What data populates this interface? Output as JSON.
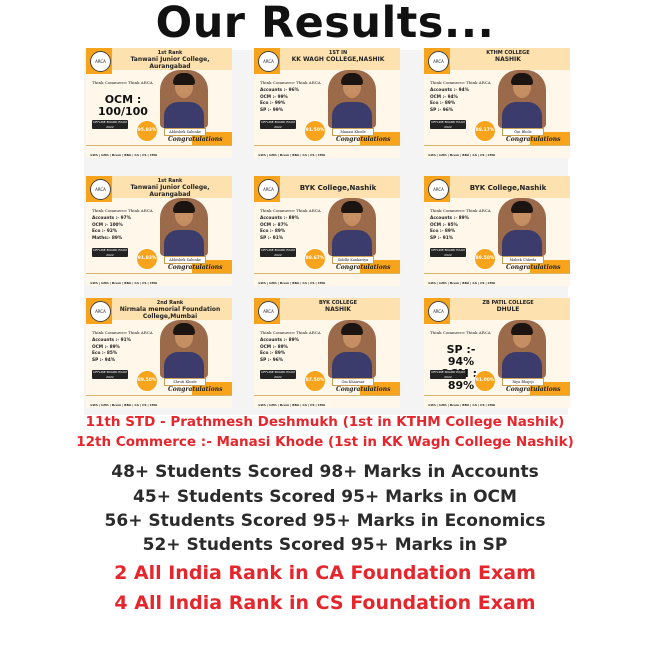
{
  "title": "Our Results...",
  "cards": [
    {
      "rank": "1st Rank",
      "college": "Tanwani Junior College, Aurangabad",
      "think": "Think Commerce Think ARCA",
      "marks": [],
      "big": "OCM : 100/100",
      "board": "OFFLINE BOARD EXAM 2022",
      "percent": "95.83%",
      "name": "Abhishek Salunke",
      "congrats": "Congratulations",
      "footer": "11th | 12th | Bcom | BBA | CA | CS | CMA",
      "logo": "ARCA"
    },
    {
      "rank": "1ST IN",
      "college": "KK WAGH COLLEGE,NASHIK",
      "think": "Think Commerce Think ARCA",
      "marks": [
        "Accounts :- 96%",
        "OCM :- 99%",
        "Eco :- 99%",
        "SP :- 99%"
      ],
      "big": "",
      "board": "OFFLINE BOARD EXAM 2022",
      "percent": "91.50%",
      "name": "Manasi Khode",
      "congrats": "Congratulations",
      "footer": "11th | 12th | Bcom | BBA | CA | CS | CMA",
      "logo": "ARCA"
    },
    {
      "rank": "KTHM COLLEGE",
      "college": "NASHIK",
      "think": "Think Commerce Think ARCA",
      "marks": [
        "Accounts :- 94%",
        "OCM :- 94%",
        "Eco :- 89%",
        "SP :- 96%"
      ],
      "big": "",
      "board": "OFFLINE BOARD EXAM 2022",
      "percent": "88.17%",
      "name": "Om Bhole",
      "congrats": "Congratulations",
      "footer": "11th | 12th | Bcom | BBA | CA | CS | CMA",
      "logo": "ARCA"
    },
    {
      "rank": "1st Rank",
      "college": "Tanwani Junior College, Aurangabad",
      "think": "Think Commerce Think ARCA",
      "marks": [
        "Accounts :- 97%",
        "OCM :- 100%",
        "Eco :- 92%",
        "Maths:- 89%"
      ],
      "big": "",
      "board": "OFFLINE BOARD EXAM 2022",
      "percent": "91.83%",
      "name": "Abhishek Salunke",
      "congrats": "Congratulations",
      "footer": "11th | 12th | Bcom | BBA | CA | CS | CMA",
      "logo": "ARCA"
    },
    {
      "rank": "BYK College,Nashik",
      "college": "",
      "think": "Think Commerce Think ARCA",
      "marks": [
        "Accounts :- 89%",
        "OCM :- 87%",
        "Eco :- 89%",
        "SP :- 91%"
      ],
      "big": "",
      "board": "OFFLINE BOARD EXAM 2022",
      "percent": "88.67%",
      "name": "Siddhi Kankariya",
      "congrats": "Congratulations",
      "footer": "11th | 12th | Bcom | BBA | CA | CS | CMA",
      "logo": "ARCA"
    },
    {
      "rank": "BYK College,Nashik",
      "college": "",
      "think": "Think Commerce Think ARCA",
      "marks": [
        "Accounts :- 89%",
        "OCM :- 95%",
        "Eco :- 89%",
        "SP :- 91%"
      ],
      "big": "",
      "board": "OFFLINE BOARD EXAM 2022",
      "percent": "89.50%",
      "name": "Mahek Chheda",
      "congrats": "Congratulations",
      "footer": "11th | 12th | Bcom | BBA | CA | CS | CMA",
      "logo": "ARCA"
    },
    {
      "rank": "2nd Rank",
      "college": "Nirmala memorial Foundation College,Mumbai",
      "think": "Think Commerce Think ARCA",
      "marks": [
        "Accounts :- 91%",
        "OCM :- 89%",
        "Eco :- 85%",
        "SP :- 94%"
      ],
      "big": "",
      "board": "OFFLINE BOARD EXAM 2022",
      "percent": "89.50%",
      "name": "Shruti Khode",
      "congrats": "Congratulations",
      "footer": "11th | 12th | Bcom | BBA | CA | CS | CMA",
      "logo": "ARCA"
    },
    {
      "rank": "BYK COLLEGE",
      "college": "NASHIK",
      "think": "Think Commerce Think ARCA",
      "marks": [
        "Accounts :- 89%",
        "OCM :- 89%",
        "Eco :- 89%",
        "SP :- 96%"
      ],
      "big": "",
      "board": "OFFLINE BOARD EXAM 2022",
      "percent": "87.50%",
      "name": "Om Khairnar",
      "congrats": "Congratulations",
      "footer": "11th | 12th | Bcom | BBA | CA | CS | CMA",
      "logo": "ARCA"
    },
    {
      "rank": "ZB PATIL COLLEGE",
      "college": "DHULE",
      "think": "Think Commerce Think ARCA",
      "marks": [],
      "big": "SP :- 94% OCM :- 89%",
      "board": "OFFLINE BOARD EXAM 2022",
      "percent": "91.00%",
      "name": "Riya Bhajeji",
      "congrats": "Congratulations",
      "footer": "11th | 12th | Bcom | BBA | CA | CS | CMA",
      "logo": "ARCA"
    }
  ],
  "highlights": [
    "11th STD - Prathmesh Deshmukh (1st in KTHM College Nashik)",
    "12th Commerce :- Manasi Khode (1st in KK Wagh College Nashik)"
  ],
  "stats": [
    "48+ Students Scored 98+ Marks in Accounts",
    "45+ Students Scored 95+ Marks in OCM",
    "56+ Students Scored 95+ Marks in Economics",
    "52+ Students Scored 95+ Marks in SP"
  ],
  "ranks": [
    "2 All India Rank in CA Foundation Exam",
    "4 All India Rank in CS Foundation Exam"
  ],
  "colors": {
    "accent": "#e5262c",
    "orange": "#f7a41c",
    "dark": "#2b2b2b"
  }
}
